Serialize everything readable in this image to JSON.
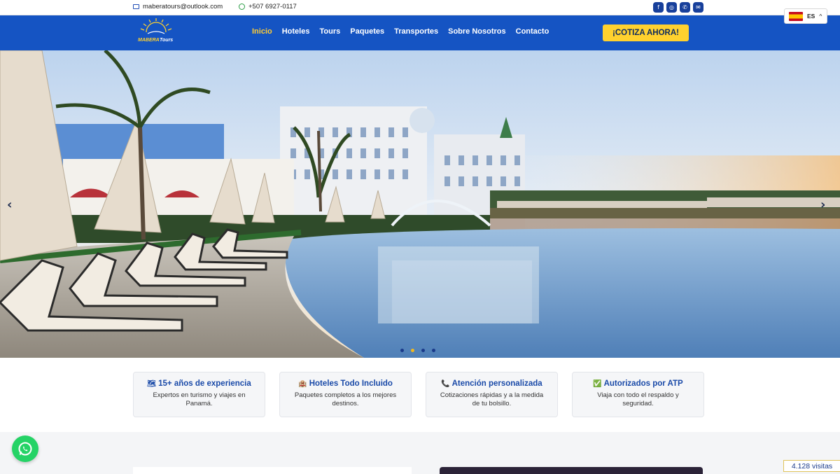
{
  "topbar": {
    "email": "maberatours@outlook.com",
    "phone": "+507 6927-0117",
    "socials": [
      {
        "icon": "facebook-icon",
        "glyph": "f"
      },
      {
        "icon": "instagram-icon",
        "glyph": "◎"
      },
      {
        "icon": "phone-icon",
        "glyph": "✆"
      },
      {
        "icon": "mail-icon",
        "glyph": "✉"
      }
    ]
  },
  "language": {
    "code": "ES",
    "caret": "^"
  },
  "brand": {
    "name": "MABERA",
    "suffix": "Tours"
  },
  "nav": {
    "items": [
      {
        "label": "Inicio",
        "active": true
      },
      {
        "label": "Hoteles",
        "active": false
      },
      {
        "label": "Tours",
        "active": false
      },
      {
        "label": "Paquetes",
        "active": false
      },
      {
        "label": "Transportes",
        "active": false
      },
      {
        "label": "Sobre Nosotros",
        "active": false
      },
      {
        "label": "Contacto",
        "active": false
      }
    ],
    "cta": "¡COTIZA AHORA!"
  },
  "hero": {
    "prev": "‹",
    "next": "›",
    "slide_count": 4,
    "active_slide": 2
  },
  "features": [
    {
      "icon": "🗺",
      "title": "15+ años de experiencia",
      "text": "Expertos en turismo y viajes en Panamá."
    },
    {
      "icon": "🏨",
      "title": "Hoteles Todo Incluido",
      "text": "Paquetes completos a los mejores destinos."
    },
    {
      "icon": "📞",
      "title": "Atención personalizada",
      "text": "Cotizaciones rápidas y a la medida de tu bolsillo."
    },
    {
      "icon": "✅",
      "title": "Autorizados por ATP",
      "text": "Viaja con todo el respaldo y seguridad."
    }
  ],
  "visits": "4.128 visitas",
  "colors": {
    "nav": "#1554c3",
    "accent": "#ffd12e",
    "active_link": "#ffcc33"
  }
}
